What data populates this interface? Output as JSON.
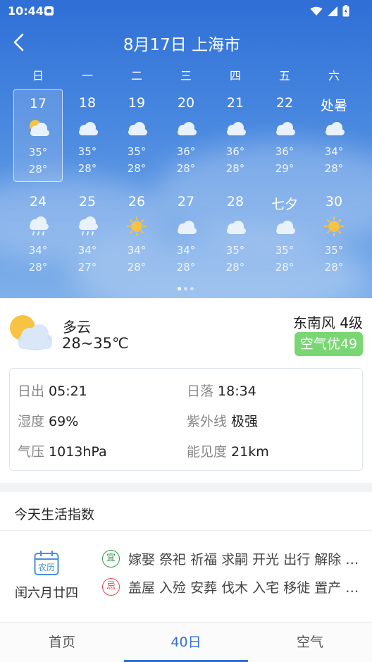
{
  "status_bar": {
    "time": "10:44",
    "icons": [
      "app-notification-icon",
      "wifi-icon",
      "signal-icon",
      "battery-icon"
    ]
  },
  "header": {
    "back_icon": "chevron-left-icon",
    "title": "8月17日 上海市"
  },
  "calendar": {
    "weekdays": [
      "日",
      "一",
      "二",
      "三",
      "四",
      "五",
      "六"
    ],
    "weeks": [
      [
        {
          "day": "17",
          "icon": "partly-cloudy",
          "hi": "35°",
          "lo": "28°",
          "selected": true
        },
        {
          "day": "18",
          "icon": "cloudy",
          "hi": "35°",
          "lo": "28°"
        },
        {
          "day": "19",
          "icon": "cloudy",
          "hi": "35°",
          "lo": "28°"
        },
        {
          "day": "20",
          "icon": "cloudy",
          "hi": "36°",
          "lo": "28°"
        },
        {
          "day": "21",
          "icon": "cloudy",
          "hi": "36°",
          "lo": "28°"
        },
        {
          "day": "22",
          "icon": "cloudy",
          "hi": "36°",
          "lo": "29°"
        },
        {
          "day": "处暑",
          "icon": "cloudy",
          "hi": "34°",
          "lo": "28°"
        }
      ],
      [
        {
          "day": "24",
          "icon": "rain",
          "hi": "34°",
          "lo": "28°"
        },
        {
          "day": "25",
          "icon": "rain",
          "hi": "34°",
          "lo": "27°"
        },
        {
          "day": "26",
          "icon": "sunny",
          "hi": "34°",
          "lo": "28°"
        },
        {
          "day": "27",
          "icon": "cloudy",
          "hi": "34°",
          "lo": "28°"
        },
        {
          "day": "28",
          "icon": "cloudy",
          "hi": "35°",
          "lo": "28°"
        },
        {
          "day": "七夕",
          "icon": "cloudy",
          "hi": "35°",
          "lo": "28°"
        },
        {
          "day": "30",
          "icon": "sunny",
          "hi": "35°",
          "lo": "28°"
        }
      ]
    ],
    "page_indicator": {
      "count": 3,
      "active": 0
    }
  },
  "today": {
    "icon": "partly-cloudy",
    "condition": "多云",
    "temp_range": "28~35℃",
    "wind": "东南风 4级",
    "aqi": "空气优49",
    "aqi_color": "#7ad672",
    "details": [
      {
        "label": "日出",
        "value": "05:21"
      },
      {
        "label": "日落",
        "value": "18:34"
      },
      {
        "label": "湿度",
        "value": "69%"
      },
      {
        "label": "紫外线",
        "value": "极强"
      },
      {
        "label": "气压",
        "value": "1013hPa"
      },
      {
        "label": "能见度",
        "value": "21km"
      }
    ]
  },
  "life": {
    "title": "今天生活指数",
    "calendar_badge": "农历",
    "lunar_date": "闰六月廿四",
    "yi_label": "宜",
    "yi_text": "嫁娶 祭祀 祈福 求嗣 开光 出行 解除 动土 入宅",
    "ji_label": "忌",
    "ji_text": "盖屋 入殓 安葬 伐木 入宅 移徙 置产 出火"
  },
  "bottom_nav": {
    "tabs": [
      "首页",
      "40日",
      "空气"
    ],
    "active": 1
  },
  "colors": {
    "accent": "#2f6fd6",
    "yi": "#2e9a4a",
    "ji": "#e04b4b"
  }
}
